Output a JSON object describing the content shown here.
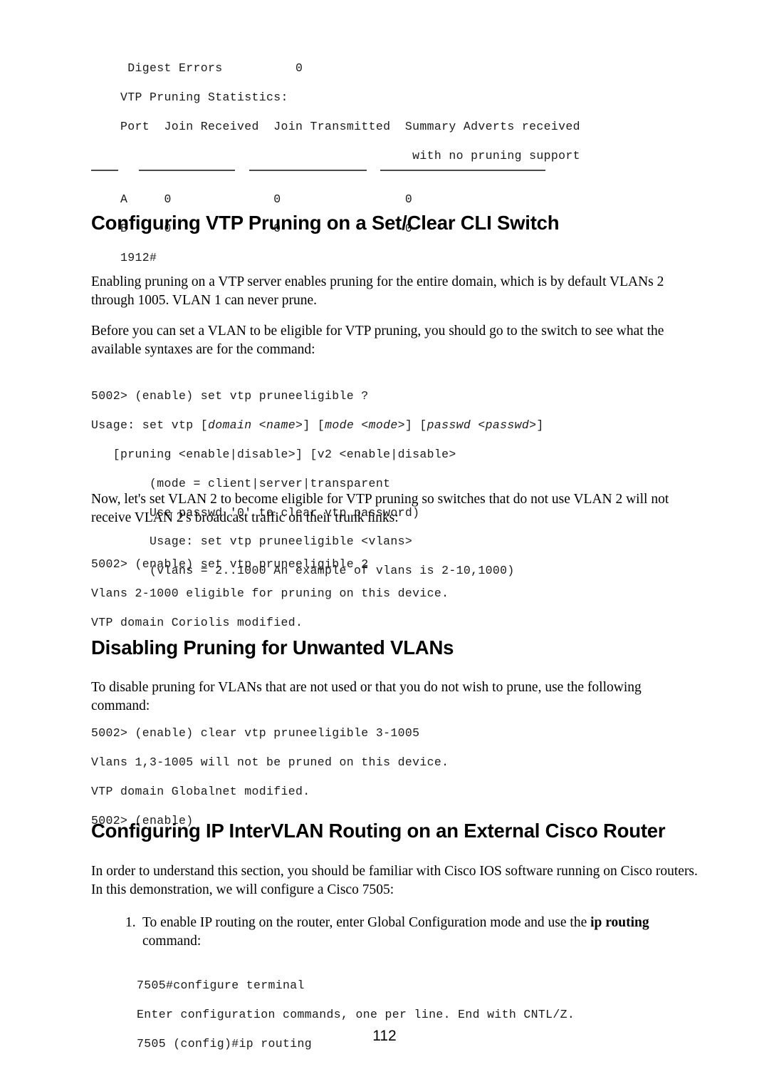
{
  "page": {
    "number": "112"
  },
  "terminal_top": {
    "lines": [
      " Digest Errors          0",
      "VTP Pruning Statistics:",
      "Port  Join Received  Join Transmitted  Summary Adverts received",
      "                                        with no pruning support",
      "A     0              0                 0",
      "B     0              0                 0",
      "1912#"
    ],
    "line_digest_errors": " Digest Errors          0",
    "line_stats_header": "VTP Pruning Statistics:",
    "line_columns": "Port  Join Received  Join Transmitted  Summary Adverts received",
    "line_columns_cont": "with no pruning support",
    "row_a": "A     0              0                 0",
    "row_b": "B     0              0                 0",
    "prompt": "1912#"
  },
  "sections": {
    "vtp_pruning_setclear": {
      "heading": "Configuring VTP Pruning on a Set/Clear CLI Switch",
      "para1": "Enabling pruning on a VTP server enables pruning for the entire domain, which is by default VLANs 2 through 1005. VLAN 1 can never prune.",
      "para2": "Before you can set a VLAN to be eligible for VTP pruning, you should go to the switch to see what the available syntaxes are for the command:",
      "code1": {
        "l1": "5002> (enable) set vtp pruneeligible ?",
        "l2_pre": "Usage: set vtp [",
        "l2_i1": "domain <name>",
        "l2_mid1": "] [",
        "l2_i2": "mode <mode>",
        "l2_mid2": "] [",
        "l2_i3": "passwd <passwd>",
        "l2_post": "]",
        "l3": "   [pruning <enable|disable>] [v2 <enable|disable>",
        "l4": "        (mode = client|server|transparent",
        "l5": "        Use passwd '0' to clear vtp password)",
        "l6": "        Usage: set vtp pruneeligible <vlans>",
        "l7": "        (vlans = 2..1000 An example of vlans is 2-10,1000)"
      },
      "para3": "Now, let's set VLAN 2 to become eligible for VTP pruning so switches that do not use VLAN 2 will not receive VLAN 2's broadcast traffic on their trunk links:",
      "code2": {
        "l1": "5002> (enable) set vtp pruneeligible 2",
        "l2": "Vlans 2-1000 eligible for pruning on this device.",
        "l3": "VTP domain Coriolis modified."
      }
    },
    "disabling_pruning": {
      "heading": "Disabling Pruning for Unwanted VLANs",
      "para1": "To disable pruning for VLANs that are not used or that you do not wish to prune, use the following command:",
      "code1": {
        "l1": "5002> (enable) clear vtp pruneeligible 3-1005",
        "l2": "Vlans 1,3-1005 will not be pruned on this device.",
        "l3": "VTP domain Globalnet modified.",
        "l4": "5002> (enable)"
      }
    },
    "intervlan_routing": {
      "heading": "Configuring IP InterVLAN Routing on an External Cisco Router",
      "para1": "In order to understand this section, you should be familiar with Cisco IOS software running on Cisco routers. In this demonstration, we will configure a Cisco 7505:",
      "list": [
        {
          "marker": "1.",
          "text_pre": "To enable IP routing on the router, enter Global Configuration mode and use the ",
          "text_bold": "ip routing",
          "text_post": " command:"
        }
      ],
      "code1": {
        "l1": "7505#configure terminal",
        "l2": "Enter configuration commands, one per line. End with CNTL/Z.",
        "l3": "7505 (config)#ip routing"
      }
    }
  }
}
